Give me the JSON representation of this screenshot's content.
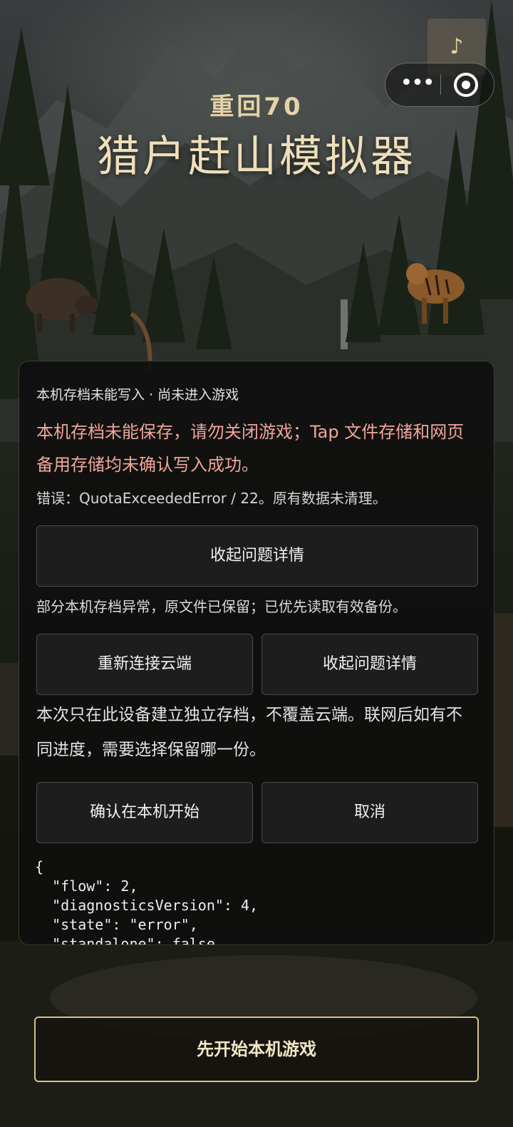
{
  "header": {
    "subtitle": "重回70",
    "title": "猎户赶山模拟器"
  },
  "capsule": {
    "more_icon": "more-dots-icon",
    "close_icon": "target-circle-icon"
  },
  "music": {
    "icon": "music-note-icon",
    "glyph": "♪"
  },
  "dialog": {
    "status": "本机存档未能写入 · 尚未进入游戏",
    "warning": "本机存档未能保存，请勿关闭游戏；Tap 文件存储和网页备用存储均未确认写入成功。",
    "error_line": "错误：QuotaExceededError / 22。原有数据未清理。",
    "collapse_details_label": "收起问题详情",
    "notice": "部分本机存档异常，原文件已保留；已优先读取有效备份。",
    "reconnect_label": "重新连接云端",
    "collapse_details_label_2": "收起问题详情",
    "standalone_note": "本次只在此设备建立独立存档，不覆盖云端。联网后如有不同进度，需要选择保留哪一份。",
    "confirm_label": "确认在本机开始",
    "cancel_label": "取消",
    "diagnostics_json": "{\n  \"flow\": 2,\n  \"diagnosticsVersion\": 4,\n  \"state\": \"error\",\n  \"standalone\": false"
  },
  "footer": {
    "start_local_label": "先开始本机游戏"
  }
}
